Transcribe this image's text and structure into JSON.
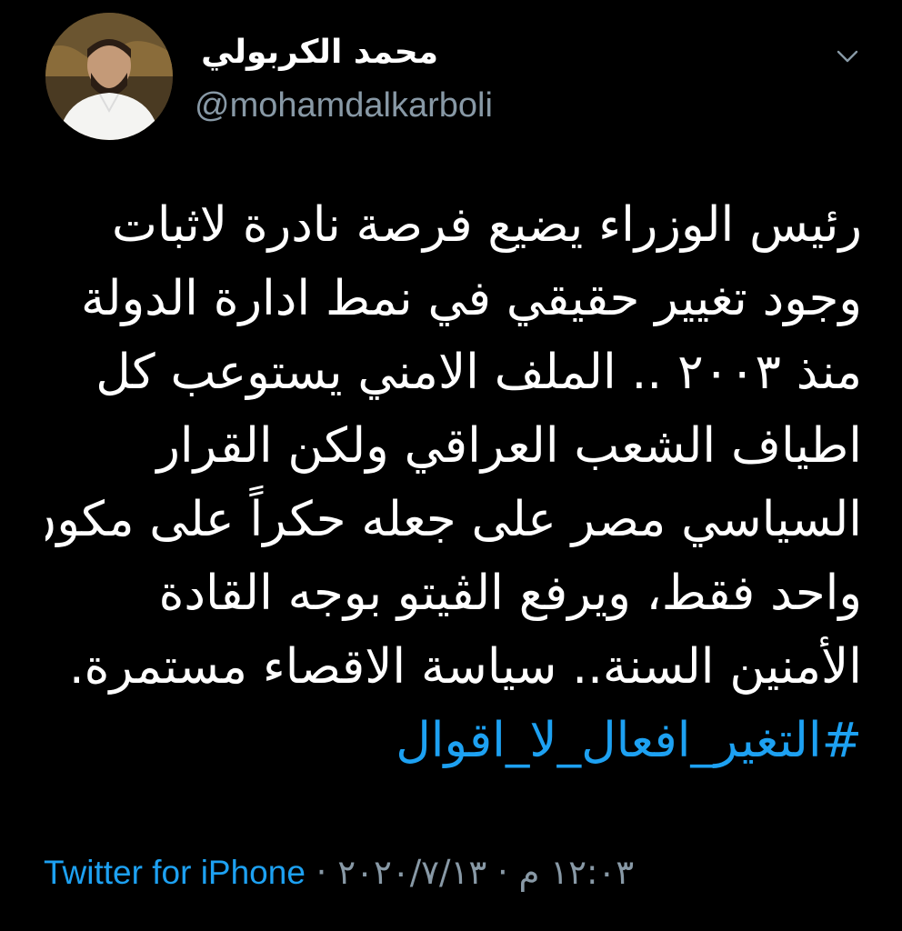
{
  "user": {
    "display_name": "محمد الكربولي",
    "handle": "@mohamdalkarboli",
    "avatar_icon": "profile-photo"
  },
  "menu": {
    "icon": "chevron-down-icon"
  },
  "tweet": {
    "lines": [
      "رئيس الوزراء يضيع فرصة نادرة لاثبات",
      "وجود تغيير حقيقي في نمط ادارة الدولة",
      "منذ ٢٠٠٣ .. الملف الامني يستوعب كل",
      "اطياف الشعب العراقي ولكن القرار",
      "السياسي مصر على جعله حكراً على مكون",
      "واحد فقط، ويرفع الڤيتو بوجه القادة",
      "الأمنين السنة.. سياسة الاقصاء مستمرة."
    ],
    "hashtag": "#التغير_افعال_لا_اقوال"
  },
  "meta": {
    "time": "١٢:٠٣ م",
    "separator": "·",
    "date": "٢٠٢٠/٧/١٣",
    "source": "Twitter for iPhone"
  },
  "colors": {
    "background": "#000000",
    "text": "#ffffff",
    "secondary": "#8899a6",
    "link": "#1da1f2"
  }
}
